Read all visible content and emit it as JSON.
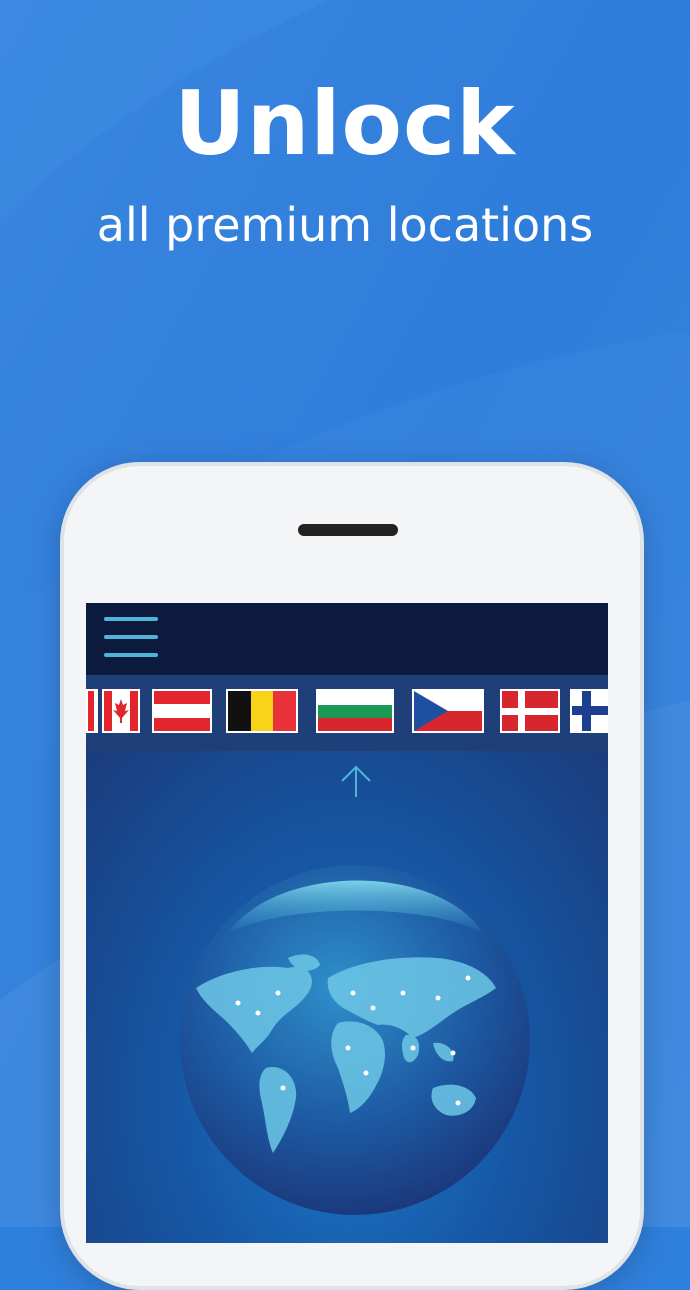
{
  "promo": {
    "headline": "Unlock",
    "subline": "all premium locations"
  },
  "colors": {
    "background": "#2f7fdc",
    "topbar": "#0c1a3d",
    "flagbar": "#1e3f78",
    "accent": "#4fb5d8"
  },
  "app": {
    "menu_icon": "hamburger-menu-icon",
    "arrow_icon": "arrow-up-icon",
    "globe": "world-map-globe",
    "flags": [
      "Canada",
      "Canada",
      "Austria",
      "Belgium",
      "Bulgaria",
      "Czech Republic",
      "Denmark",
      "Finland"
    ]
  }
}
